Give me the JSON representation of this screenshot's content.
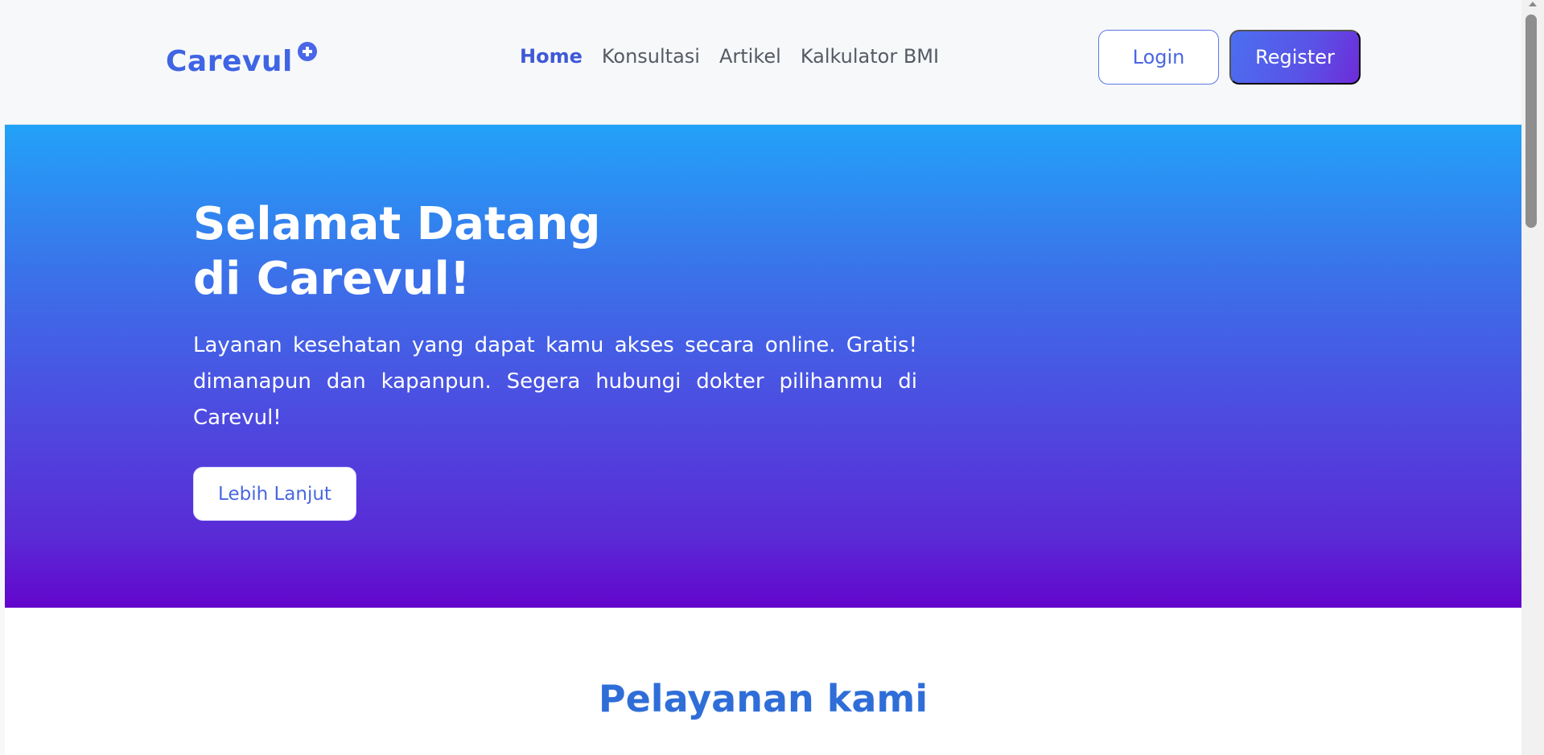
{
  "navbar": {
    "brand": "Carevul",
    "brand_icon": "plus-circle-icon",
    "links": [
      {
        "label": "Home",
        "active": true
      },
      {
        "label": "Konsultasi",
        "active": false
      },
      {
        "label": "Artikel",
        "active": false
      },
      {
        "label": "Kalkulator BMI",
        "active": false
      }
    ],
    "login_label": "Login",
    "register_label": "Register"
  },
  "hero": {
    "title_line1": "Selamat Datang",
    "title_line2": "di Carevul!",
    "description": "Layanan kesehatan yang dapat kamu akses secara online. Gratis! dimanapun dan kapanpun. Segera hubungi dokter pilihanmu di Carevul!",
    "cta_label": "Lebih Lanjut",
    "gradient_top": "#22a2f8",
    "gradient_bottom": "#6305cc"
  },
  "services": {
    "title": "Pelayanan kami"
  },
  "colors": {
    "accent": "#3f64e4",
    "heading_blue": "#2f6ed8",
    "register_gradient_end": "#6e2bd9"
  }
}
